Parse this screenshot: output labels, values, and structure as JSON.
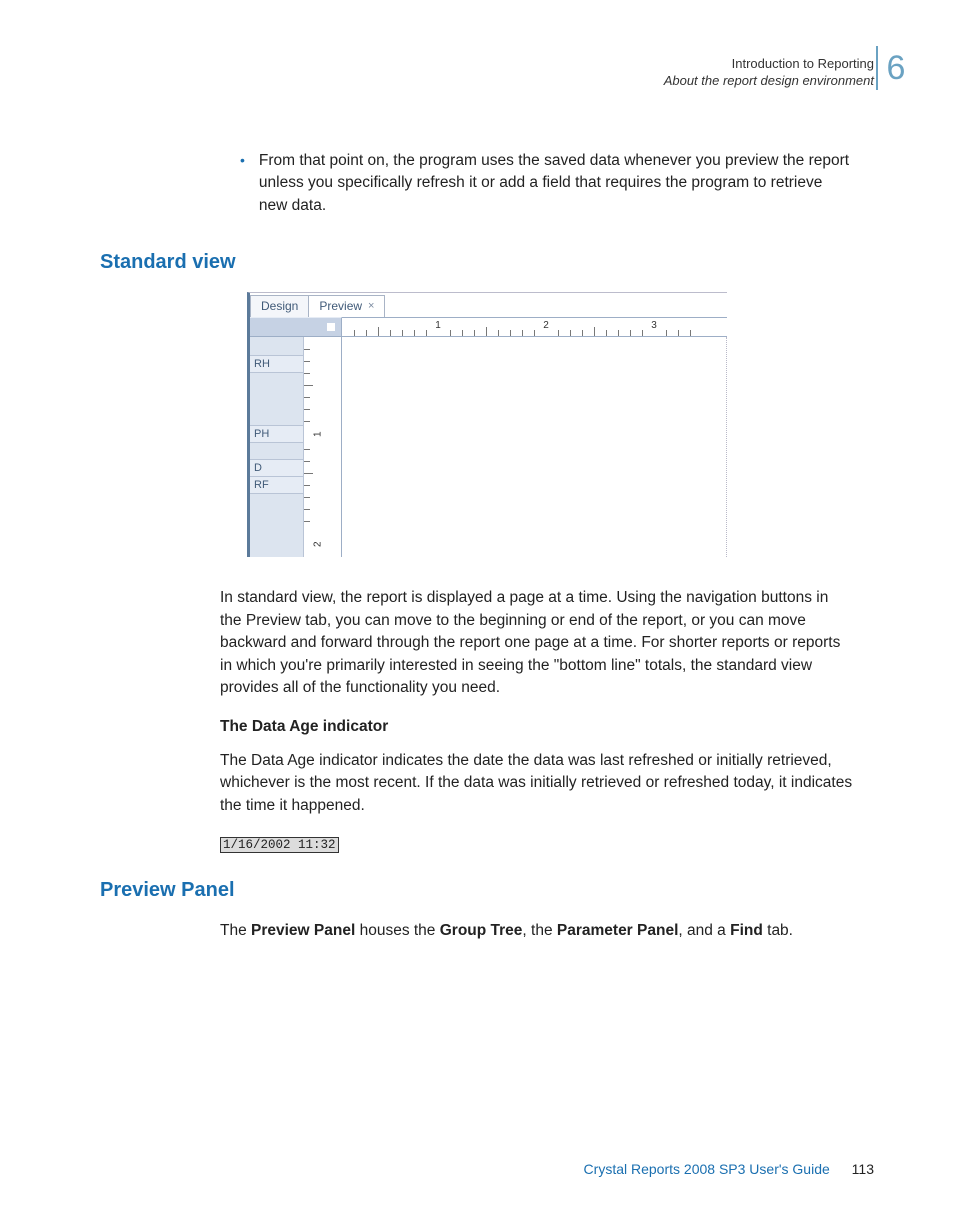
{
  "header": {
    "line1": "Introduction to Reporting",
    "line2": "About the report design environment",
    "chapter": "6"
  },
  "bullet": {
    "text": "From that point on, the program uses the saved data whenever you preview the report unless you specifically refresh it or add a field that requires the program to retrieve new data."
  },
  "sections": {
    "standard_view": "Standard view",
    "preview_panel": "Preview Panel"
  },
  "figure": {
    "tab_design": "Design",
    "tab_preview": "Preview",
    "ruler_marks": [
      "1",
      "2",
      "3"
    ],
    "vruler_marks": [
      "1",
      "2"
    ],
    "bands": {
      "rh": "RH",
      "ph": "PH",
      "d": "D",
      "rf": "RF"
    }
  },
  "paragraphs": {
    "p1": "In standard view, the report is displayed a page at a time. Using the navigation buttons in the Preview tab, you can move to the beginning or end of the report, or you can move backward and forward through the report one page at a time. For shorter reports or reports in which you're primarily interested in seeing the \"bottom line\" totals, the standard view provides all of the functionality you need.",
    "data_age_heading": "The Data Age indicator",
    "p2": "The Data Age indicator indicates the date the data was last refreshed or initially retrieved, whichever is the most recent. If the data was initially retrieved or refreshed today, it indicates the time it happened.",
    "timestamp": "1/16/2002 11:32",
    "p3_pre": "The ",
    "p3_b1": "Preview Panel",
    "p3_mid1": " houses the ",
    "p3_b2": "Group Tree",
    "p3_mid2": ", the ",
    "p3_b3": "Parameter Panel",
    "p3_mid3": ", and a ",
    "p3_b4": "Find",
    "p3_end": " tab."
  },
  "footer": {
    "title": "Crystal Reports 2008 SP3 User's Guide",
    "page": "113"
  }
}
